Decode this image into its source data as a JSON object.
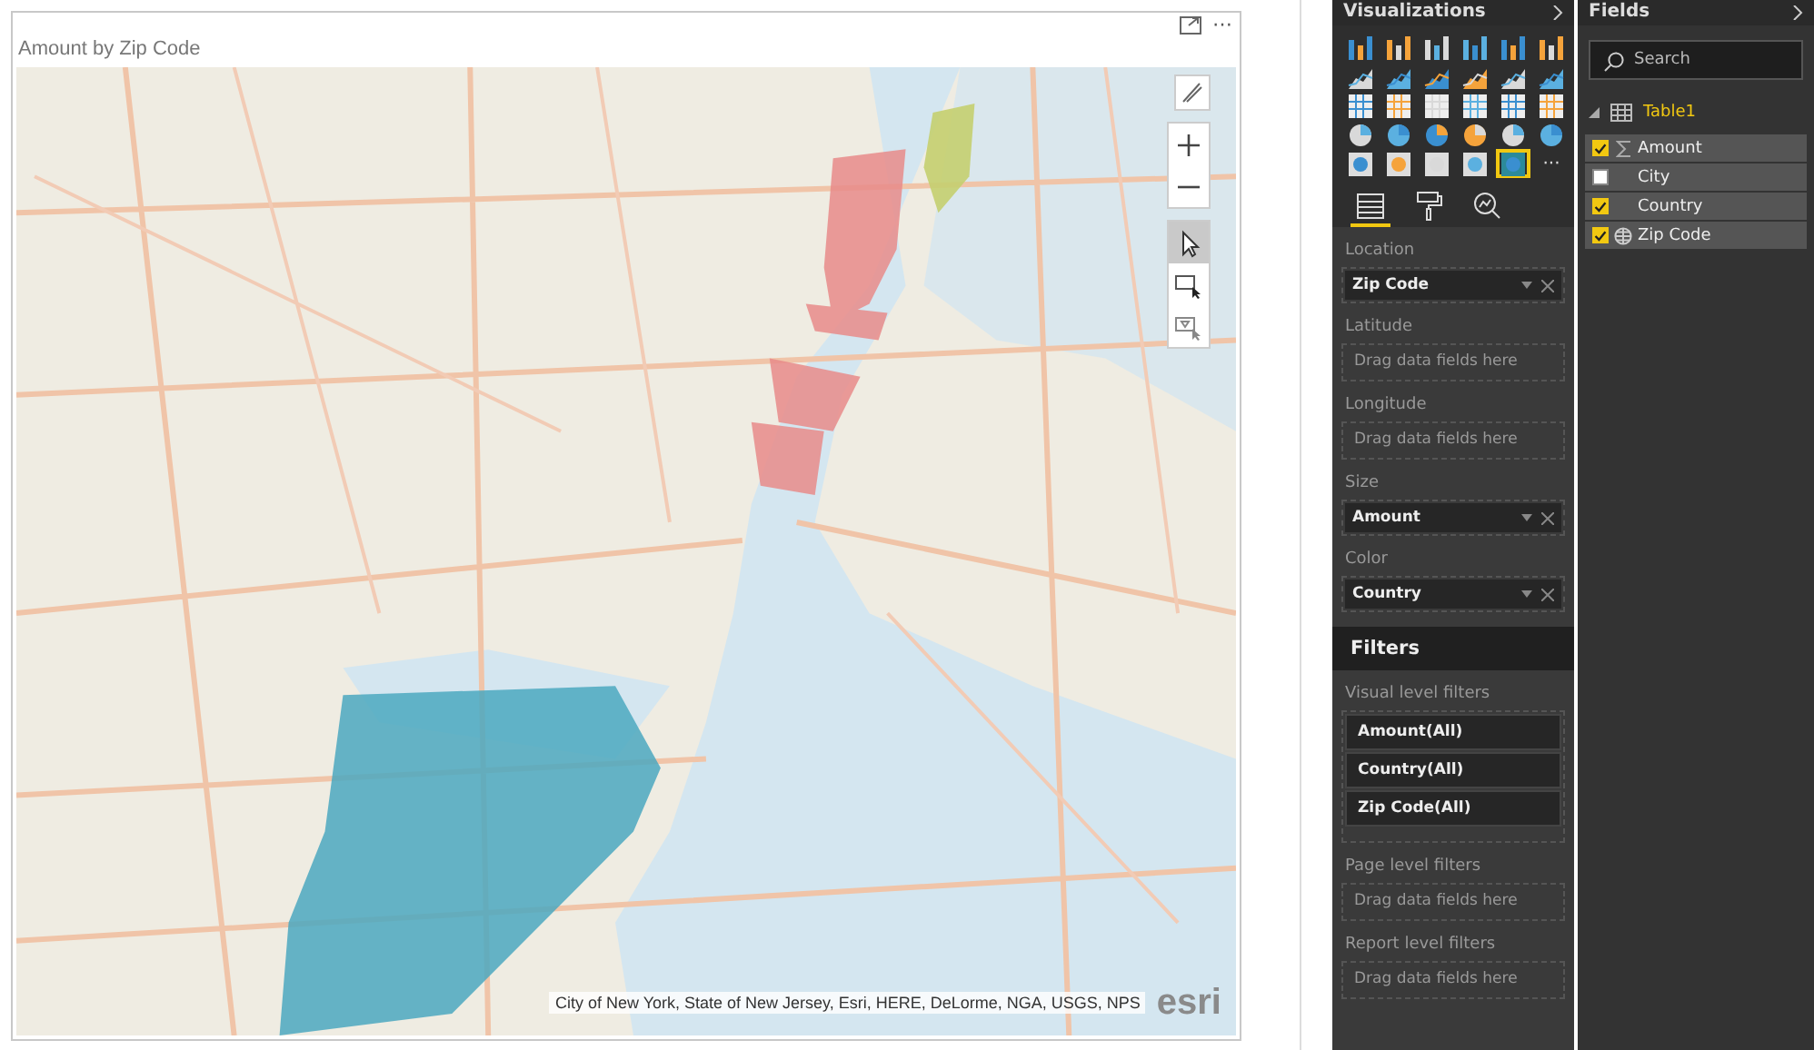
{
  "visual": {
    "title": "Amount by Zip Code",
    "more": "⋯",
    "attribution": "City of New York, State of New Jersey, Esri, HERE, DeLorme, NGA, USGS, NPS",
    "logo": "esri",
    "map_controls": [
      {
        "kind": "draw"
      },
      {
        "kind": "zoom-in"
      },
      {
        "kind": "zoom-out"
      },
      {
        "kind": "select",
        "selected": true
      },
      {
        "kind": "rect-select",
        "selected": false
      },
      {
        "kind": "lasso-select",
        "selected": false
      }
    ]
  },
  "visualizations": {
    "title": "Visualizations",
    "types": [
      {
        "selected": false
      },
      {
        "selected": false
      },
      {
        "selected": false
      },
      {
        "selected": false
      },
      {
        "selected": false
      },
      {
        "selected": false
      },
      {
        "selected": false
      },
      {
        "selected": false
      },
      {
        "selected": false
      },
      {
        "selected": false
      },
      {
        "selected": false
      },
      {
        "selected": false
      },
      {
        "selected": false
      },
      {
        "selected": false
      },
      {
        "selected": false
      },
      {
        "selected": false
      },
      {
        "selected": false
      },
      {
        "selected": false
      },
      {
        "selected": false
      },
      {
        "selected": false
      },
      {
        "selected": false
      },
      {
        "selected": false
      },
      {
        "selected": false
      },
      {
        "selected": false
      },
      {
        "selected": false
      },
      {
        "selected": false
      },
      {
        "selected": false
      },
      {
        "selected": false
      },
      {
        "selected": true
      }
    ],
    "more": "···",
    "tabs": [
      {
        "kind": "fields",
        "selected": true
      },
      {
        "kind": "format",
        "selected": false
      },
      {
        "kind": "analytics",
        "selected": false
      }
    ],
    "wells": [
      {
        "label": "Location",
        "value": "Zip Code"
      },
      {
        "label": "Latitude",
        "placeholder": "Drag data fields here"
      },
      {
        "label": "Longitude",
        "placeholder": "Drag data fields here"
      },
      {
        "label": "Size",
        "value": "Amount"
      },
      {
        "label": "Color",
        "value": "Country"
      }
    ]
  },
  "filters": {
    "title": "Filters",
    "sections": [
      {
        "label": "Visual level filters",
        "items": [
          "Amount(All)",
          "Country(All)",
          "Zip Code(All)"
        ]
      },
      {
        "label": "Page level filters",
        "placeholder": "Drag data fields here"
      },
      {
        "label": "Report level filters",
        "placeholder": "Drag data fields here"
      }
    ]
  },
  "fields": {
    "title": "Fields",
    "search": {
      "placeholder": "Search"
    },
    "tables": [
      {
        "name": "Table1",
        "expanded": true,
        "fields": [
          {
            "name": "Amount",
            "checked": true,
            "kind": "measure"
          },
          {
            "name": "City",
            "checked": false,
            "kind": "text"
          },
          {
            "name": "Country",
            "checked": true,
            "kind": "text"
          },
          {
            "name": "Zip Code",
            "checked": true,
            "kind": "geo"
          }
        ]
      }
    ]
  }
}
